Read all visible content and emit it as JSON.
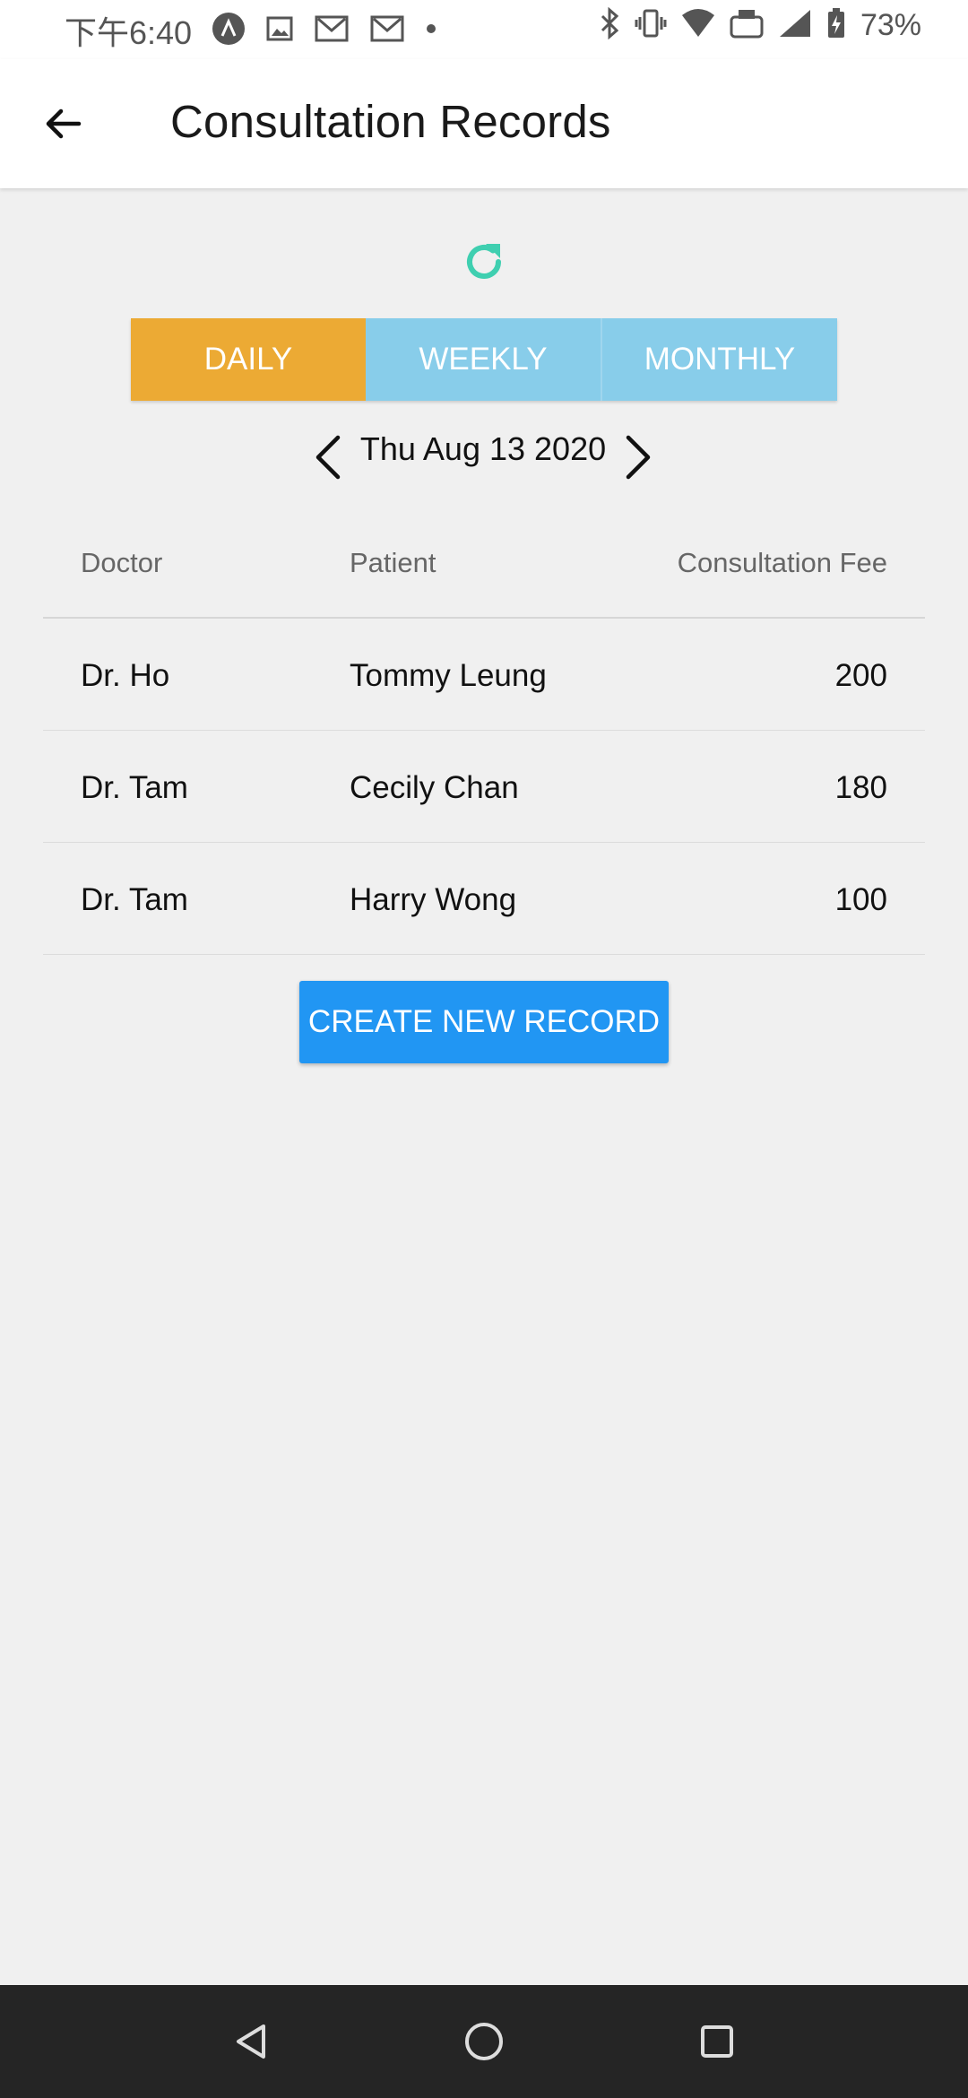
{
  "status_bar": {
    "time": "下午6:40",
    "battery": "73%",
    "icons": [
      "app-icon",
      "image-icon",
      "gmail-icon",
      "gmail-icon",
      "dot-icon",
      "bluetooth-icon",
      "vibrate-icon",
      "wifi-icon",
      "volte-icon",
      "signal-icon",
      "battery-charging-icon"
    ]
  },
  "app_bar": {
    "title": "Consultation Records",
    "back_icon": "arrow-left-icon"
  },
  "refresh_icon": "refresh-icon",
  "accent_color": "#3fcfb0",
  "tabs": [
    {
      "label": "DAILY",
      "active": true,
      "color": "#ecaa34"
    },
    {
      "label": "WEEKLY",
      "active": false,
      "color": "#88cdea"
    },
    {
      "label": "MONTHLY",
      "active": false,
      "color": "#88cdea"
    }
  ],
  "date_nav": {
    "date": "Thu Aug 13 2020",
    "prev_icon": "chevron-left-icon",
    "next_icon": "chevron-right-icon"
  },
  "table": {
    "headers": {
      "doctor": "Doctor",
      "patient": "Patient",
      "fee": "Consultation Fee"
    },
    "rows": [
      {
        "doctor": "Dr. Ho",
        "patient": "Tommy Leung",
        "fee": "200"
      },
      {
        "doctor": "Dr. Tam",
        "patient": "Cecily Chan",
        "fee": "180"
      },
      {
        "doctor": "Dr. Tam",
        "patient": "Harry Wong",
        "fee": "100"
      }
    ]
  },
  "create_button": {
    "label": "CREATE NEW RECORD",
    "color": "#2196f3"
  },
  "nav_bar": {
    "icons": [
      "back-triangle-icon",
      "home-circle-icon",
      "recents-square-icon"
    ]
  }
}
